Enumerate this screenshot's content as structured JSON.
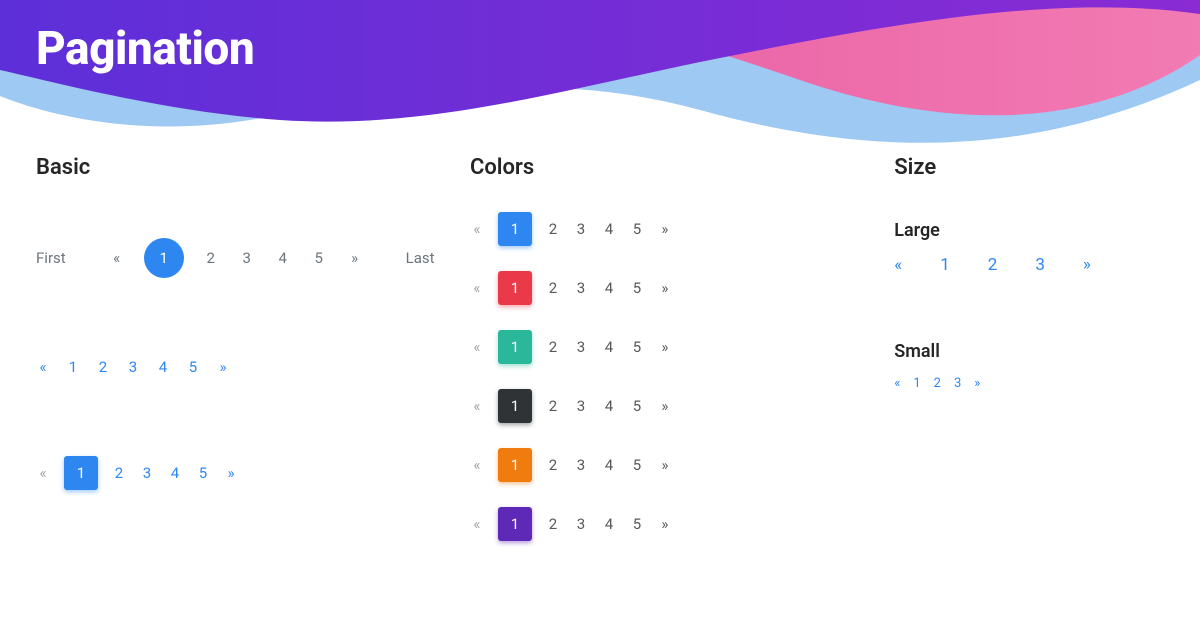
{
  "title": "Pagination",
  "sections": {
    "basic_heading": "Basic",
    "colors_heading": "Colors",
    "size_heading": "Size",
    "size_large_label": "Large",
    "size_small_label": "Small"
  },
  "glyphs": {
    "first": "First",
    "last": "Last",
    "prev": "«",
    "next": "»"
  },
  "basic": {
    "circle": {
      "active": "1",
      "pages": [
        "1",
        "2",
        "3",
        "4",
        "5"
      ]
    },
    "plain": {
      "pages": [
        "1",
        "2",
        "3",
        "4",
        "5"
      ]
    },
    "square": {
      "active": "1",
      "pages": [
        "1",
        "2",
        "3",
        "4",
        "5"
      ]
    }
  },
  "colors_rows": [
    {
      "name": "blue",
      "class": "c-blue"
    },
    {
      "name": "red",
      "class": "c-red"
    },
    {
      "name": "teal",
      "class": "c-teal"
    },
    {
      "name": "dark",
      "class": "c-dark"
    },
    {
      "name": "orange",
      "class": "c-orange"
    },
    {
      "name": "purple",
      "class": "c-purple"
    }
  ],
  "colors_pages": [
    "1",
    "2",
    "3",
    "4",
    "5"
  ],
  "size_large_pages": [
    "1",
    "2",
    "3"
  ],
  "size_small_pages": [
    "1",
    "2",
    "3"
  ],
  "hero_colors": {
    "purple_a": "#5d2fd8",
    "purple_b": "#8a2bd4",
    "blue": "#9ec9f3",
    "pink_a": "#e95fa3",
    "pink_b": "#f27bb3"
  }
}
